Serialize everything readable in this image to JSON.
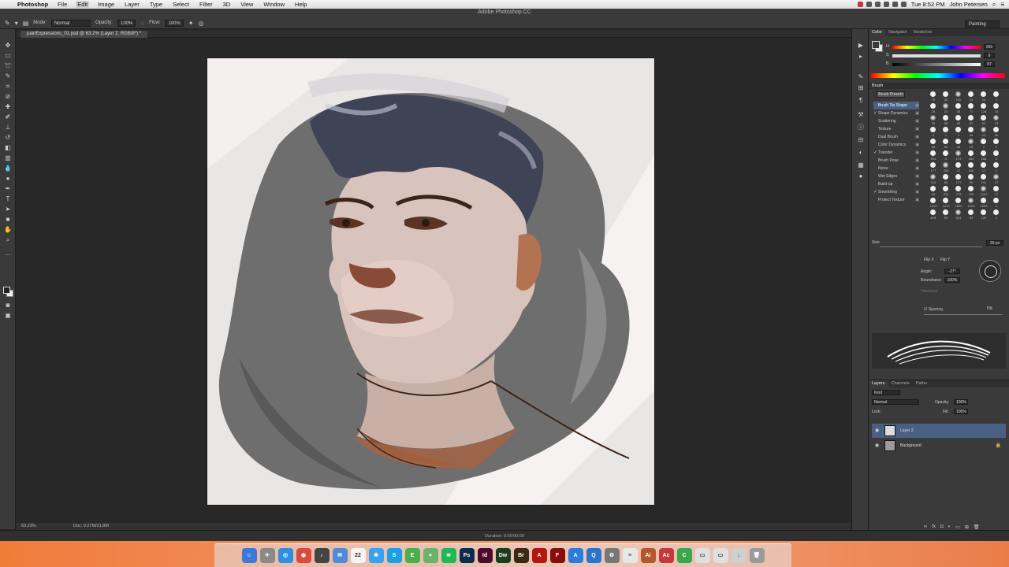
{
  "menubar": {
    "app_name": "Photoshop",
    "items": [
      "File",
      "Edit",
      "Image",
      "Layer",
      "Type",
      "Select",
      "Filter",
      "3D",
      "View",
      "Window",
      "Help"
    ],
    "active_item": "Edit",
    "clock": "Tue 8:52 PM",
    "user": "John Petersen"
  },
  "window_title": "Adobe Photoshop CC",
  "options": {
    "mode_label": "Mode:",
    "mode_value": "Normal",
    "opacity_label": "Opacity:",
    "opacity_value": "100%",
    "flow_label": "Flow:",
    "flow_value": "100%",
    "workspace": "Painting"
  },
  "document": {
    "tab_title": "painExpressions_01.psd @ 63.2% (Layer 2, RGB/8*) *",
    "zoom": "63.23%",
    "doc_size": "Doc: 9.27M/21.8M",
    "duration": "Duration: 0:00:00:00"
  },
  "color_panel": {
    "tabs": [
      "Color",
      "Navigator",
      "Swatches"
    ],
    "h_label": "H",
    "s_label": "S",
    "b_label": "B",
    "h_value": "255",
    "s_value": "9",
    "b_value": "87",
    "foreground": "#3a3a3a",
    "background": "#ececec"
  },
  "brush_panel": {
    "tab": "Brush",
    "presets_button": "Brush Presets",
    "options": [
      {
        "label": "Brush Tip Shape",
        "checked": false,
        "selected": true
      },
      {
        "label": "Shape Dynamics",
        "checked": true,
        "selected": false
      },
      {
        "label": "Scattering",
        "checked": false,
        "selected": false
      },
      {
        "label": "Texture",
        "checked": false,
        "selected": false
      },
      {
        "label": "Dual Brush",
        "checked": false,
        "selected": false
      },
      {
        "label": "Color Dynamics",
        "checked": false,
        "selected": false
      },
      {
        "label": "Transfer",
        "checked": true,
        "selected": false
      },
      {
        "label": "Brush Pose",
        "checked": false,
        "selected": false
      },
      {
        "label": "Noise",
        "checked": false,
        "selected": false
      },
      {
        "label": "Wet Edges",
        "checked": false,
        "selected": false
      },
      {
        "label": "Build-up",
        "checked": false,
        "selected": false
      },
      {
        "label": "Smoothing",
        "checked": true,
        "selected": false
      },
      {
        "label": "Protect Texture",
        "checked": false,
        "selected": false
      }
    ],
    "tip_sizes": [
      "70",
      "30",
      "100",
      "14",
      "14",
      "1",
      "26",
      "22",
      "36",
      "71",
      "128",
      "14",
      "25",
      "38",
      "63",
      "57",
      "60",
      "24",
      "1",
      "1",
      "1",
      "54",
      "22",
      "36",
      "58",
      "96",
      "48",
      "25",
      "1",
      "1",
      "294",
      "5",
      "173",
      "463",
      "266",
      "1",
      "177",
      "255",
      "17",
      "160",
      "17",
      "1",
      "110",
      "65",
      "177",
      "59",
      "141",
      "17",
      "90",
      "334",
      "275",
      "100",
      "1247",
      "17",
      "1313",
      "1413",
      "1800",
      "1000",
      "1000",
      "1",
      "678",
      "53",
      "414",
      "53",
      "126",
      "1"
    ],
    "size_label": "Size",
    "size_value": "30 px",
    "flip_x": "Flip X",
    "flip_y": "Flip Y",
    "angle_label": "Angle:",
    "angle_value": "-27°",
    "roundness_label": "Roundness:",
    "roundness_value": "100%",
    "hardness_label": "Hardness",
    "spacing_label": "Spacing",
    "spacing_value": "5%"
  },
  "layers_panel": {
    "tabs": [
      "Layers",
      "Channels",
      "Paths"
    ],
    "kind_label": "Kind",
    "blend_mode": "Normal",
    "opacity_label": "Opacity:",
    "opacity_value": "100%",
    "lock_label": "Lock:",
    "fill_label": "Fill:",
    "fill_value": "100%",
    "layers": [
      {
        "name": "Layer 2",
        "selected": true,
        "locked": false
      },
      {
        "name": "Background",
        "selected": false,
        "locked": true
      }
    ]
  },
  "dock": {
    "icons": [
      {
        "name": "finder-icon",
        "color": "#3d7ad6",
        "glyph": "☺"
      },
      {
        "name": "launchpad-icon",
        "color": "#8a8a8a",
        "glyph": "✈"
      },
      {
        "name": "safari-icon",
        "color": "#2e8fe0",
        "glyph": "◎"
      },
      {
        "name": "chrome-icon",
        "color": "#d94b3c",
        "glyph": "◉"
      },
      {
        "name": "itunes-icon",
        "color": "#444444",
        "glyph": "♪"
      },
      {
        "name": "mail-icon",
        "color": "#4f8bd6",
        "glyph": "✉"
      },
      {
        "name": "calendar-icon",
        "color": "#f5f5f5",
        "glyph": "22"
      },
      {
        "name": "messages-icon",
        "color": "#3aa0f0",
        "glyph": "✱"
      },
      {
        "name": "skype-icon",
        "color": "#1aa0e8",
        "glyph": "S"
      },
      {
        "name": "evernote-icon",
        "color": "#4bb04b",
        "glyph": "E"
      },
      {
        "name": "maps-icon",
        "color": "#6cb36a",
        "glyph": "⌖"
      },
      {
        "name": "spotify-icon",
        "color": "#1db954",
        "glyph": "≋"
      },
      {
        "name": "photoshop-icon",
        "color": "#0d2a4f",
        "glyph": "Ps"
      },
      {
        "name": "indesign-icon",
        "color": "#4a0b2e",
        "glyph": "Id"
      },
      {
        "name": "dreamweaver-icon",
        "color": "#1b3d1d",
        "glyph": "Dw"
      },
      {
        "name": "bridge-icon",
        "color": "#3a2a14",
        "glyph": "Br"
      },
      {
        "name": "acrobat-icon",
        "color": "#b4170d",
        "glyph": "A"
      },
      {
        "name": "flash-icon",
        "color": "#8a0d0d",
        "glyph": "F"
      },
      {
        "name": "appstore-icon",
        "color": "#2c7be0",
        "glyph": "A"
      },
      {
        "name": "quicktime-icon",
        "color": "#2a74c9",
        "glyph": "Q"
      },
      {
        "name": "system-preferences-icon",
        "color": "#777777",
        "glyph": "⚙"
      },
      {
        "name": "textedit-icon",
        "color": "#e8e8e8",
        "glyph": "≡"
      },
      {
        "name": "illustrator-icon",
        "color": "#b4572b",
        "glyph": "Ai"
      },
      {
        "name": "adobe-app-icon",
        "color": "#c43a3a",
        "glyph": "Ac"
      },
      {
        "name": "camtasia-icon",
        "color": "#3aa84a",
        "glyph": "C"
      },
      {
        "name": "folder-icon",
        "color": "#e0e0e0",
        "glyph": "▭"
      },
      {
        "name": "folder-icon-2",
        "color": "#e0e0e0",
        "glyph": "▭"
      },
      {
        "name": "downloads-icon",
        "color": "#cfcfcf",
        "glyph": "↓"
      },
      {
        "name": "trash-icon",
        "color": "#9a9a9a",
        "glyph": "🗑"
      }
    ]
  }
}
